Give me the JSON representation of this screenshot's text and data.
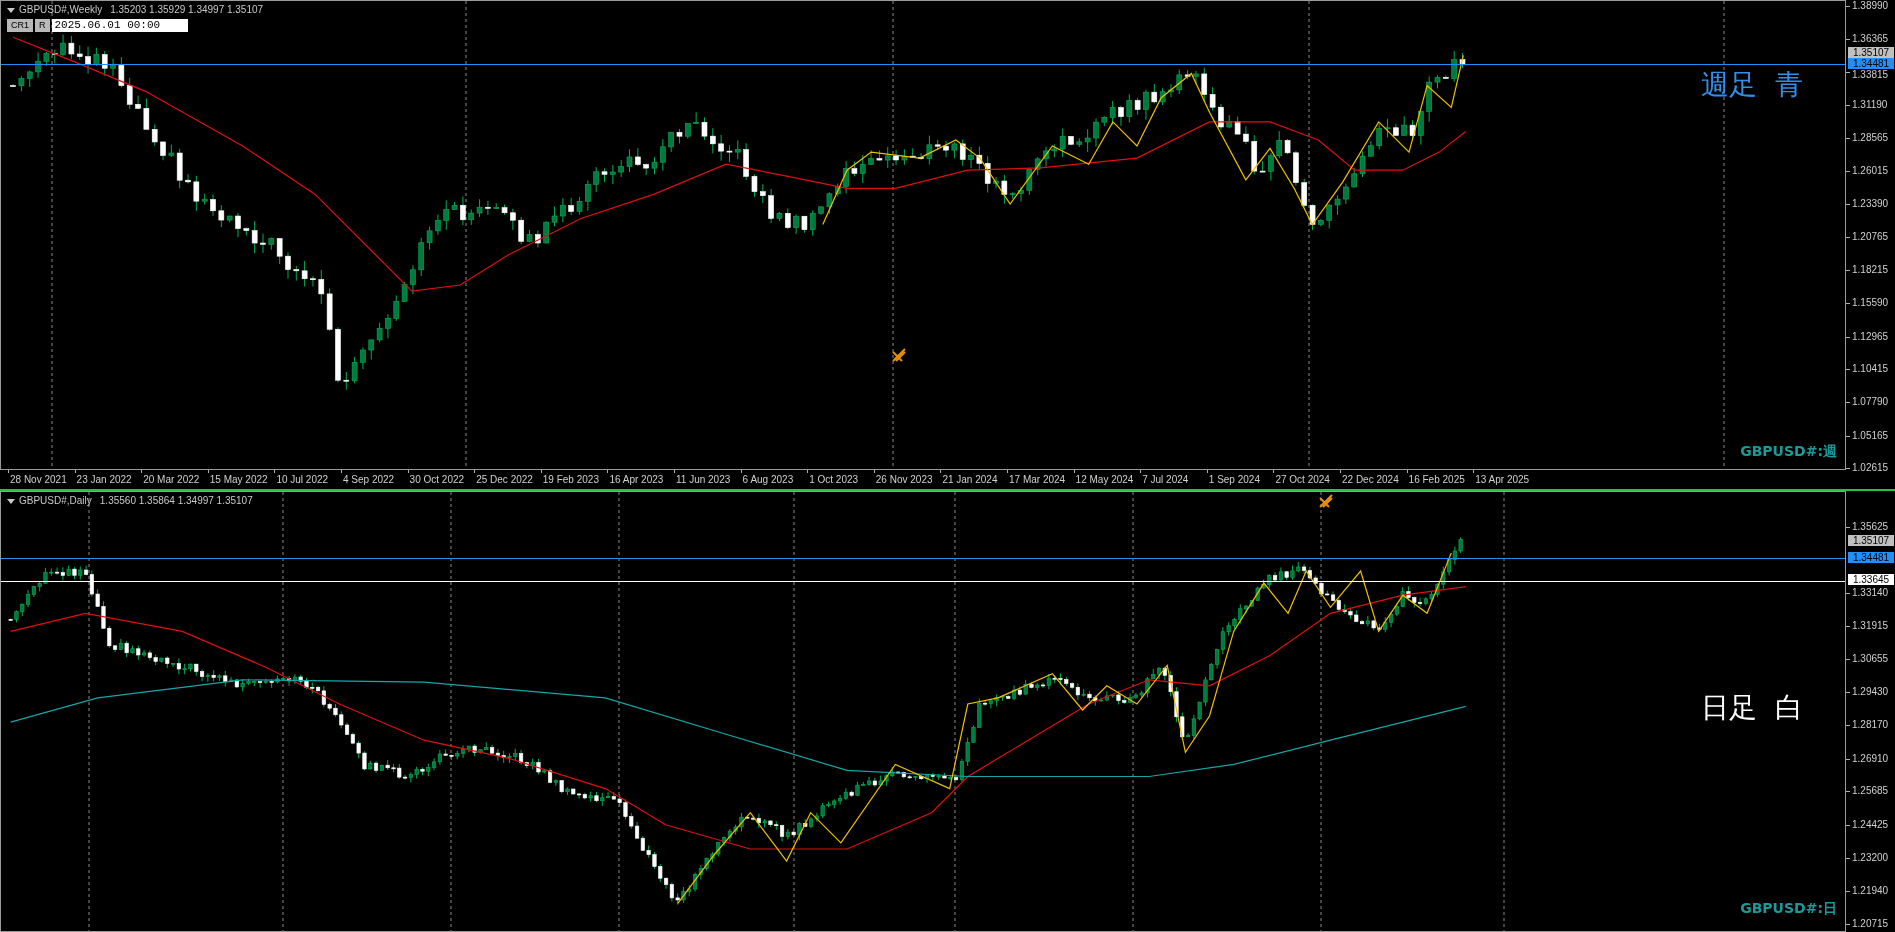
{
  "charts": [
    {
      "kind": "weekly",
      "title": "GBPUSD#,Weekly",
      "ohlc": "1.35203 1.35929 1.34997 1.35107",
      "tool_buttons": [
        "CR1",
        "R"
      ],
      "date_value": "2025.06.01 00:00",
      "price_ticks": [
        "1.38990",
        "1.36365",
        "1.33815",
        "1.31190",
        "1.28565",
        "1.26015",
        "1.23390",
        "1.20765",
        "1.18215",
        "1.15590",
        "1.12965",
        "1.10415",
        "1.07790",
        "1.05165",
        "1.02615"
      ],
      "markers": [
        {
          "text": "1.35107",
          "color": "#c0c0c0"
        },
        {
          "text": "1.34481",
          "color": "#1e90ff"
        }
      ],
      "dates": [
        "28 Nov 2021",
        "23 Jan 2022",
        "20 Mar 2022",
        "15 May 2022",
        "10 Jul 2022",
        "4 Sep 2022",
        "30 Oct 2022",
        "25 Dec 2022",
        "19 Feb 2023",
        "16 Apr 2023",
        "11 Jun 2023",
        "6 Aug 2023",
        "1 Oct 2023",
        "26 Nov 2023",
        "21 Jan 2024",
        "17 Mar 2024",
        "12 May 2024",
        "7 Jul 2024",
        "1 Sep 2024",
        "27 Oct 2024",
        "22 Dec 2024",
        "16 Feb 2025",
        "13 Apr 2025"
      ],
      "note": "週足  青",
      "symbol_label": "GBPUSD#:週"
    },
    {
      "kind": "daily",
      "title": "GBPUSD#,Daily",
      "ohlc": "1.35560 1.35864 1.34997 1.35107",
      "price_ticks": [
        "1.35625",
        "1.33140",
        "1.31915",
        "1.30655",
        "1.29430",
        "1.28170",
        "1.26910",
        "1.25685",
        "1.24425",
        "1.23200",
        "1.21940",
        "1.20715"
      ],
      "markers": [
        {
          "text": "1.35107",
          "color": "#c0c0c0"
        },
        {
          "text": "1.34481",
          "color": "#1e90ff"
        },
        {
          "text": "1.33645",
          "color": "#ffffff"
        }
      ],
      "note": "日足  白",
      "symbol_label": "GBPUSD#:日"
    }
  ]
}
